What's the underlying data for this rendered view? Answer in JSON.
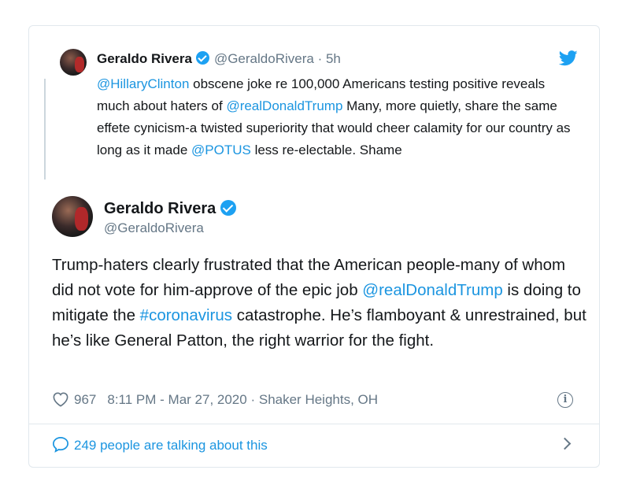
{
  "parent_tweet": {
    "name": "Geraldo Rivera",
    "handle": "@GeraldoRivera",
    "separator": "·",
    "time": "5h",
    "text_parts": {
      "m1": "@HillaryClinton",
      "t1": " obscene joke re 100,000 Americans testing positive reveals much about haters of ",
      "m2": "@realDonaldTrump",
      "t2": " Many, more quietly, share the same effete cynicism-a twisted superiority that would cheer calamity for our country as long as it made ",
      "m3": "@POTUS",
      "t3": " less re-electable. Shame"
    },
    "icons": [
      "verified-icon",
      "twitter-bird-icon"
    ]
  },
  "main_tweet": {
    "name": "Geraldo Rivera",
    "handle": "@GeraldoRivera",
    "text_parts": {
      "t1": "Trump-haters clearly  frustrated that the American people-many of whom did not vote for him-approve of the epic job ",
      "m1": "@realDonaldTrump",
      "t2": " is doing to mitigate the ",
      "h1": "#coronavirus",
      "t3": " catastrophe. He’s flamboyant & unrestrained, but he’s like General Patton, the right warrior for the fight."
    },
    "likes": "967",
    "timestamp": "8:11 PM - Mar 27, 2020",
    "meta_separator": "·",
    "location": "Shaker Heights, OH",
    "icons": [
      "heart-icon",
      "info-icon"
    ]
  },
  "footer": {
    "talking_label": "249 people are talking about this",
    "icons": [
      "speech-bubble-icon",
      "chevron-right-icon"
    ]
  },
  "colors": {
    "link": "#1b95e0",
    "verified": "#1da1f2",
    "secondary_text": "#657786",
    "border": "#e1e8ed"
  }
}
